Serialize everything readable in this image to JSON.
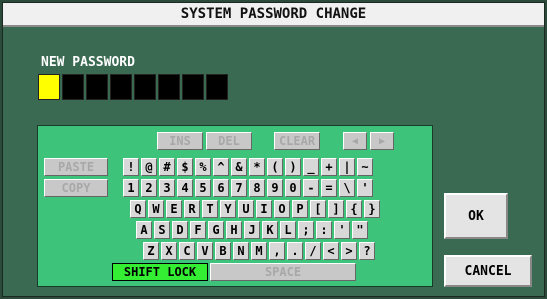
{
  "dialog": {
    "title": "SYSTEM PASSWORD CHANGE"
  },
  "password": {
    "label": "NEW PASSWORD",
    "slots": 8,
    "active_slot": 0
  },
  "edit_keys": {
    "ins": "INS",
    "del": "DEL",
    "clear": "CLEAR",
    "left": "◀",
    "right": "▶"
  },
  "side_keys": {
    "paste": "PASTE",
    "copy": "COPY"
  },
  "rows": [
    [
      "!",
      "@",
      "#",
      "$",
      "%",
      "^",
      "&",
      "*",
      "(",
      ")",
      "_",
      "+",
      "|",
      "~"
    ],
    [
      "1",
      "2",
      "3",
      "4",
      "5",
      "6",
      "7",
      "8",
      "9",
      "0",
      "-",
      "=",
      "\\",
      "'"
    ],
    [
      "Q",
      "W",
      "E",
      "R",
      "T",
      "Y",
      "U",
      "I",
      "O",
      "P",
      "[",
      "]",
      "{",
      "}"
    ],
    [
      "A",
      "S",
      "D",
      "F",
      "G",
      "H",
      "J",
      "K",
      "L",
      ";",
      ":",
      "'",
      "\""
    ],
    [
      "Z",
      "X",
      "C",
      "V",
      "B",
      "N",
      "M",
      ",",
      ".",
      "/",
      "<",
      ">",
      "?"
    ]
  ],
  "bottom": {
    "shift": "SHIFT LOCK",
    "space": "SPACE"
  },
  "actions": {
    "ok": "OK",
    "cancel": "CANCEL"
  }
}
